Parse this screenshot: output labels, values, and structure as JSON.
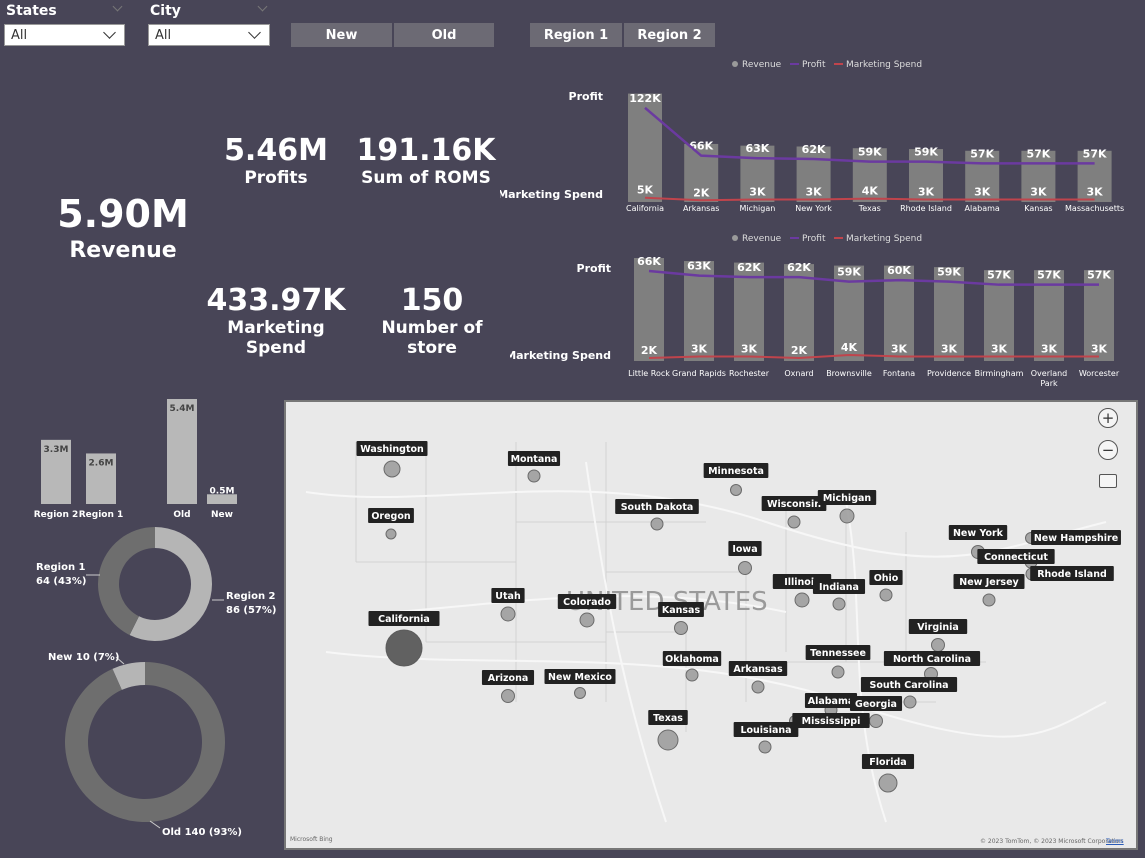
{
  "slicers": {
    "states": {
      "label": "States",
      "value": "All"
    },
    "city": {
      "label": "City",
      "value": "All"
    }
  },
  "buttons": {
    "new": "New",
    "old": "Old",
    "region1": "Region 1",
    "region2": "Region 2"
  },
  "kpis": {
    "revenue": {
      "value": "5.90M",
      "label": "Revenue"
    },
    "profits": {
      "value": "5.46M",
      "label": "Profits"
    },
    "roms": {
      "value": "191.16K",
      "label": "Sum of ROMS"
    },
    "marketing": {
      "value": "433.97K",
      "label": "Marketing Spend"
    },
    "stores": {
      "value": "150",
      "label": "Number of store"
    }
  },
  "colors": {
    "bar": "#7f7f7f",
    "profit": "#6b3aa0",
    "marketing": "#c0444c",
    "background": "#484557"
  },
  "chart_data": [
    {
      "type": "bar",
      "legend": [
        "Revenue",
        "Profit",
        "Marketing Spend"
      ],
      "row_labels": {
        "profit": "Profit",
        "marketing": "Marketing Spend"
      },
      "categories": [
        "California",
        "Arkansas",
        "Michigan",
        "New York",
        "Texas",
        "Rhode Island",
        "Alabama",
        "Kansas",
        "Massachusetts"
      ],
      "profit_labels": [
        "122K",
        "66K",
        "63K",
        "62K",
        "59K",
        "59K",
        "57K",
        "57K",
        "57K"
      ],
      "marketing_labels": [
        "5K",
        "2K",
        "3K",
        "3K",
        "4K",
        "3K",
        "3K",
        "3K",
        "3K"
      ],
      "revenue": [
        127,
        68,
        66,
        65,
        63,
        62,
        60,
        60,
        60
      ],
      "profit": [
        122,
        66,
        63,
        62,
        59,
        59,
        57,
        57,
        57
      ],
      "marketing": [
        5,
        2,
        3,
        3,
        4,
        3,
        3,
        3,
        3
      ],
      "ylim": [
        0,
        130
      ]
    },
    {
      "type": "bar",
      "legend": [
        "Revenue",
        "Profit",
        "Marketing Spend"
      ],
      "row_labels": {
        "profit": "Profit",
        "marketing": "Marketing Spend"
      },
      "categories": [
        "Little Rock",
        "Grand Rapids",
        "Rochester",
        "Oxnard",
        "Brownsville",
        "Fontana",
        "Providence",
        "Birmingham",
        "Overland Park",
        "Worcester"
      ],
      "profit_labels": [
        "66K",
        "63K",
        "62K",
        "62K",
        "59K",
        "60K",
        "59K",
        "57K",
        "57K",
        "57K"
      ],
      "marketing_labels": [
        "2K",
        "3K",
        "3K",
        "2K",
        "4K",
        "3K",
        "3K",
        "3K",
        "3K",
        "3K"
      ],
      "revenue": [
        68,
        66,
        65,
        64,
        63,
        63,
        62,
        60,
        60,
        60
      ],
      "profit": [
        66,
        63,
        62,
        62,
        59,
        60,
        59,
        57,
        57,
        57
      ],
      "marketing": [
        2,
        3,
        3,
        2,
        4,
        3,
        3,
        3,
        3,
        3
      ],
      "ylim": [
        0,
        70
      ]
    },
    {
      "type": "bar",
      "categories": [
        "Region 2",
        "Region 1",
        "Old",
        "New"
      ],
      "values": [
        3.3,
        2.6,
        5.4,
        0.5
      ],
      "labels": [
        "3.3M",
        "2.6M",
        "5.4M",
        "0.5M"
      ],
      "ylim": [
        0,
        5.4
      ]
    },
    {
      "type": "pie",
      "donut": true,
      "slices": [
        {
          "name": "Region 1",
          "value": 64,
          "label": "Region 1",
          "sub": "64 (43%)"
        },
        {
          "name": "Region 2",
          "value": 86,
          "label": "Region 2",
          "sub": "86 (57%)"
        }
      ]
    },
    {
      "type": "pie",
      "donut": true,
      "slices": [
        {
          "name": "New",
          "value": 10,
          "label": "New 10 (7%)"
        },
        {
          "name": "Old",
          "value": 140,
          "label": "Old 140 (93%)"
        }
      ]
    }
  ],
  "map": {
    "country_label": "UNITED STATES",
    "states": [
      {
        "name": "Washington",
        "v": 16
      },
      {
        "name": "Oregon",
        "v": 10
      },
      {
        "name": "California",
        "v": 36
      },
      {
        "name": "Montana",
        "v": 12
      },
      {
        "name": "Minnesota",
        "v": 11
      },
      {
        "name": "South Dakota",
        "v": 12
      },
      {
        "name": "Wisconsin",
        "v": 12
      },
      {
        "name": "Michigan",
        "v": 14
      },
      {
        "name": "Iowa",
        "v": 13
      },
      {
        "name": "Utah",
        "v": 14
      },
      {
        "name": "Colorado",
        "v": 14
      },
      {
        "name": "Kansas",
        "v": 13
      },
      {
        "name": "Illinois",
        "v": 14
      },
      {
        "name": "Indiana",
        "v": 12
      },
      {
        "name": "Ohio",
        "v": 12
      },
      {
        "name": "New York",
        "v": 13
      },
      {
        "name": "New Hampshire",
        "v": 11
      },
      {
        "name": "Connecticut",
        "v": 12
      },
      {
        "name": "Rhode Island",
        "v": 12
      },
      {
        "name": "New Jersey",
        "v": 12
      },
      {
        "name": "Virginia",
        "v": 13
      },
      {
        "name": "Tennessee",
        "v": 12
      },
      {
        "name": "North Carolina",
        "v": 13
      },
      {
        "name": "South Carolina",
        "v": 12
      },
      {
        "name": "Oklahoma",
        "v": 12
      },
      {
        "name": "Arkansas",
        "v": 12
      },
      {
        "name": "Arizona",
        "v": 13
      },
      {
        "name": "New Mexico",
        "v": 11
      },
      {
        "name": "Alabama",
        "v": 12
      },
      {
        "name": "Georgia",
        "v": 13
      },
      {
        "name": "Mississippi",
        "v": 11
      },
      {
        "name": "Texas",
        "v": 20
      },
      {
        "name": "Louisiana",
        "v": 12
      },
      {
        "name": "Florida",
        "v": 18
      }
    ],
    "footer": "© 2023 TomTom, © 2023 Microsoft Corporation",
    "terms": "Terms",
    "brand": "Microsoft Bing"
  }
}
